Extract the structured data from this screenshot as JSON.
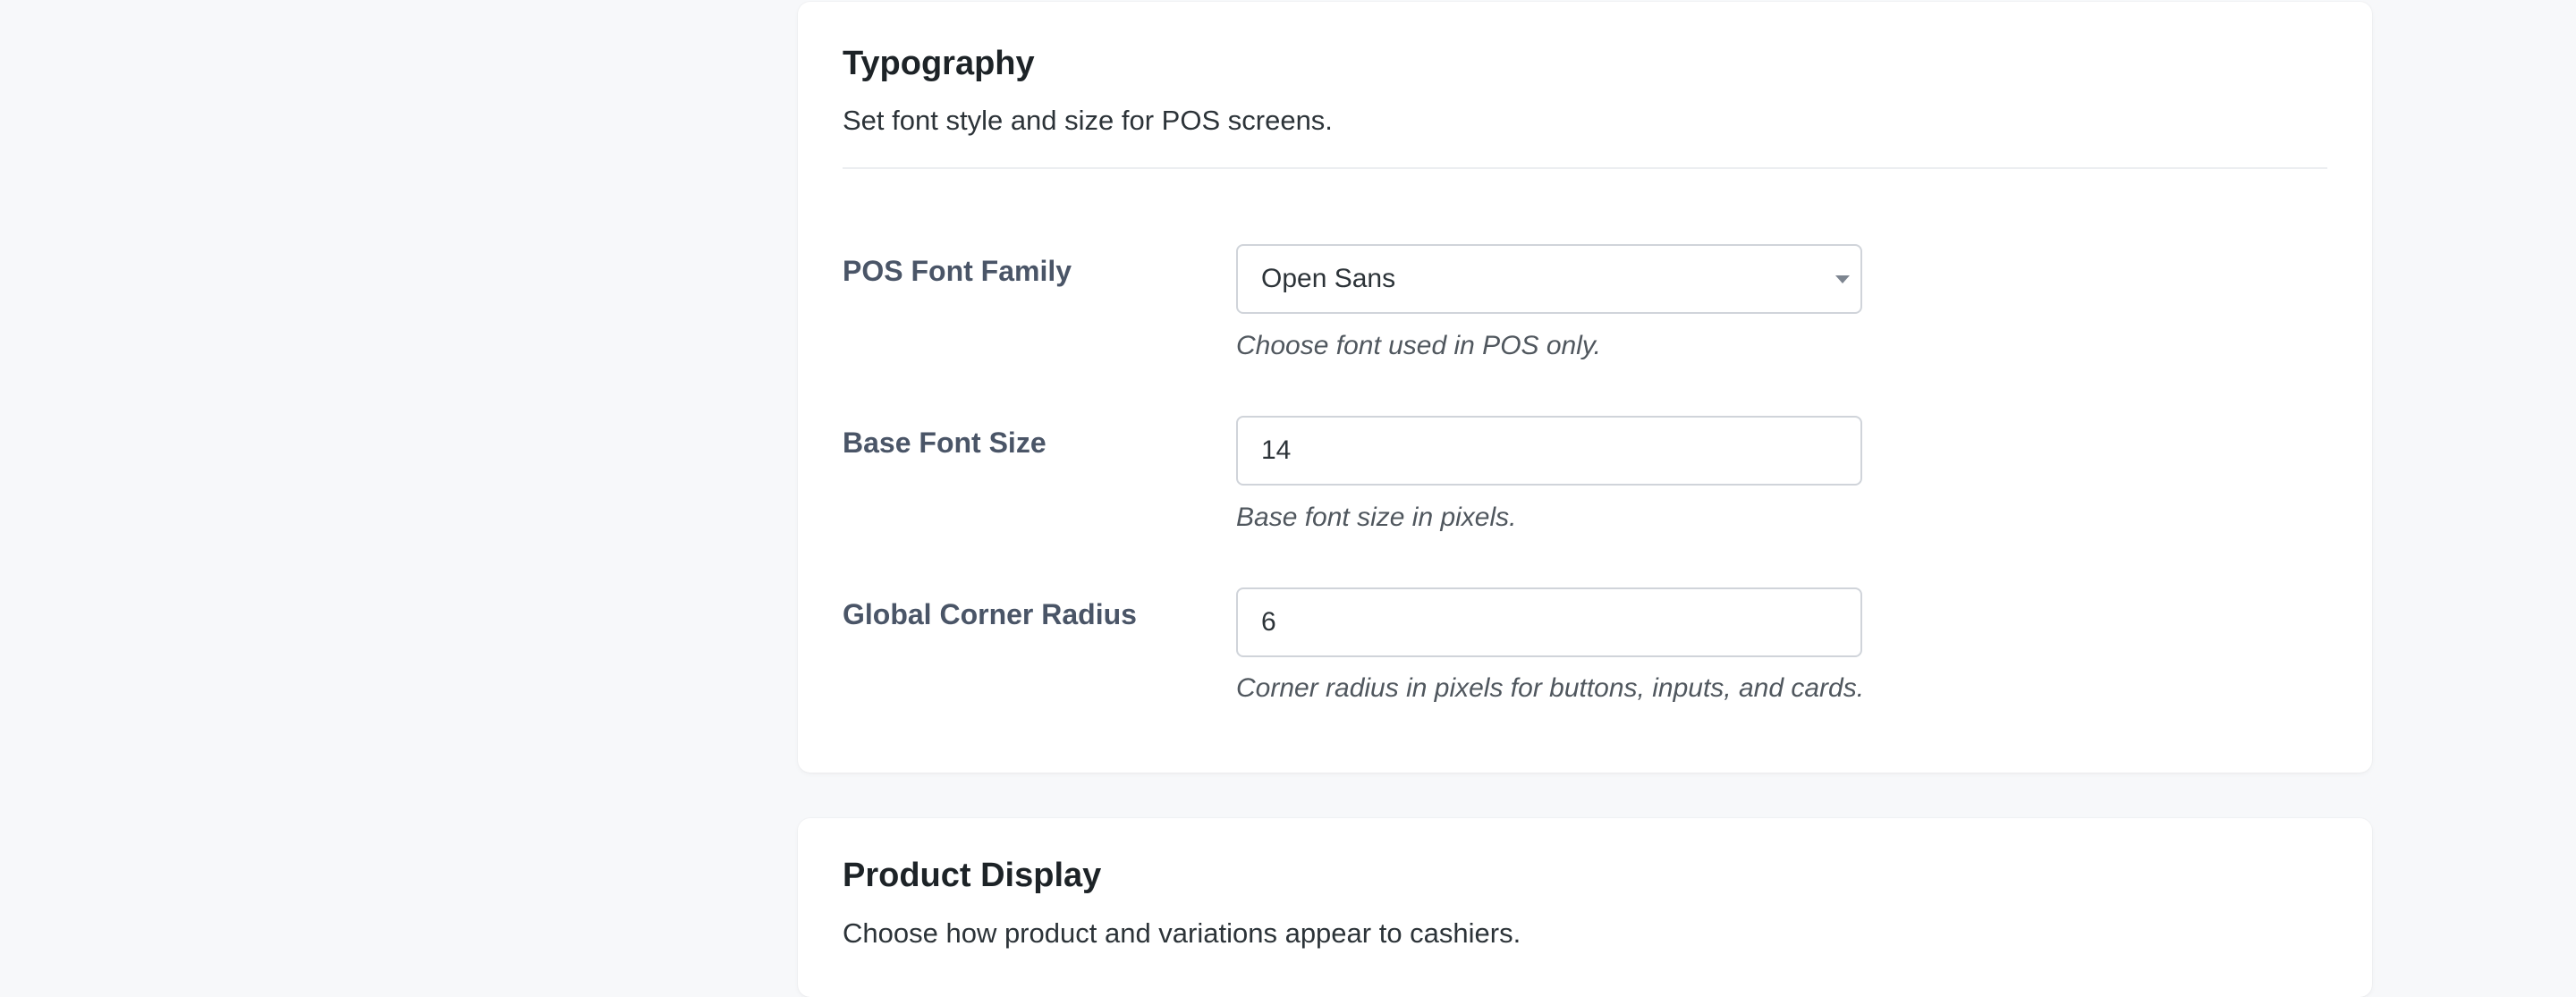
{
  "typography": {
    "title": "Typography",
    "description": "Set font style and size for POS screens.",
    "fields": {
      "font_family": {
        "label": "POS Font Family",
        "value": "Open Sans",
        "help": "Choose font used in POS only."
      },
      "base_font_size": {
        "label": "Base Font Size",
        "value": "14",
        "help": "Base font size in pixels."
      },
      "corner_radius": {
        "label": "Global Corner Radius",
        "value": "6",
        "help": "Corner radius in pixels for buttons, inputs, and cards."
      }
    }
  },
  "product_display": {
    "title": "Product Display",
    "description": "Choose how product and variations appear to cashiers."
  },
  "icons": {
    "select_caret": "chevron-down-icon"
  }
}
